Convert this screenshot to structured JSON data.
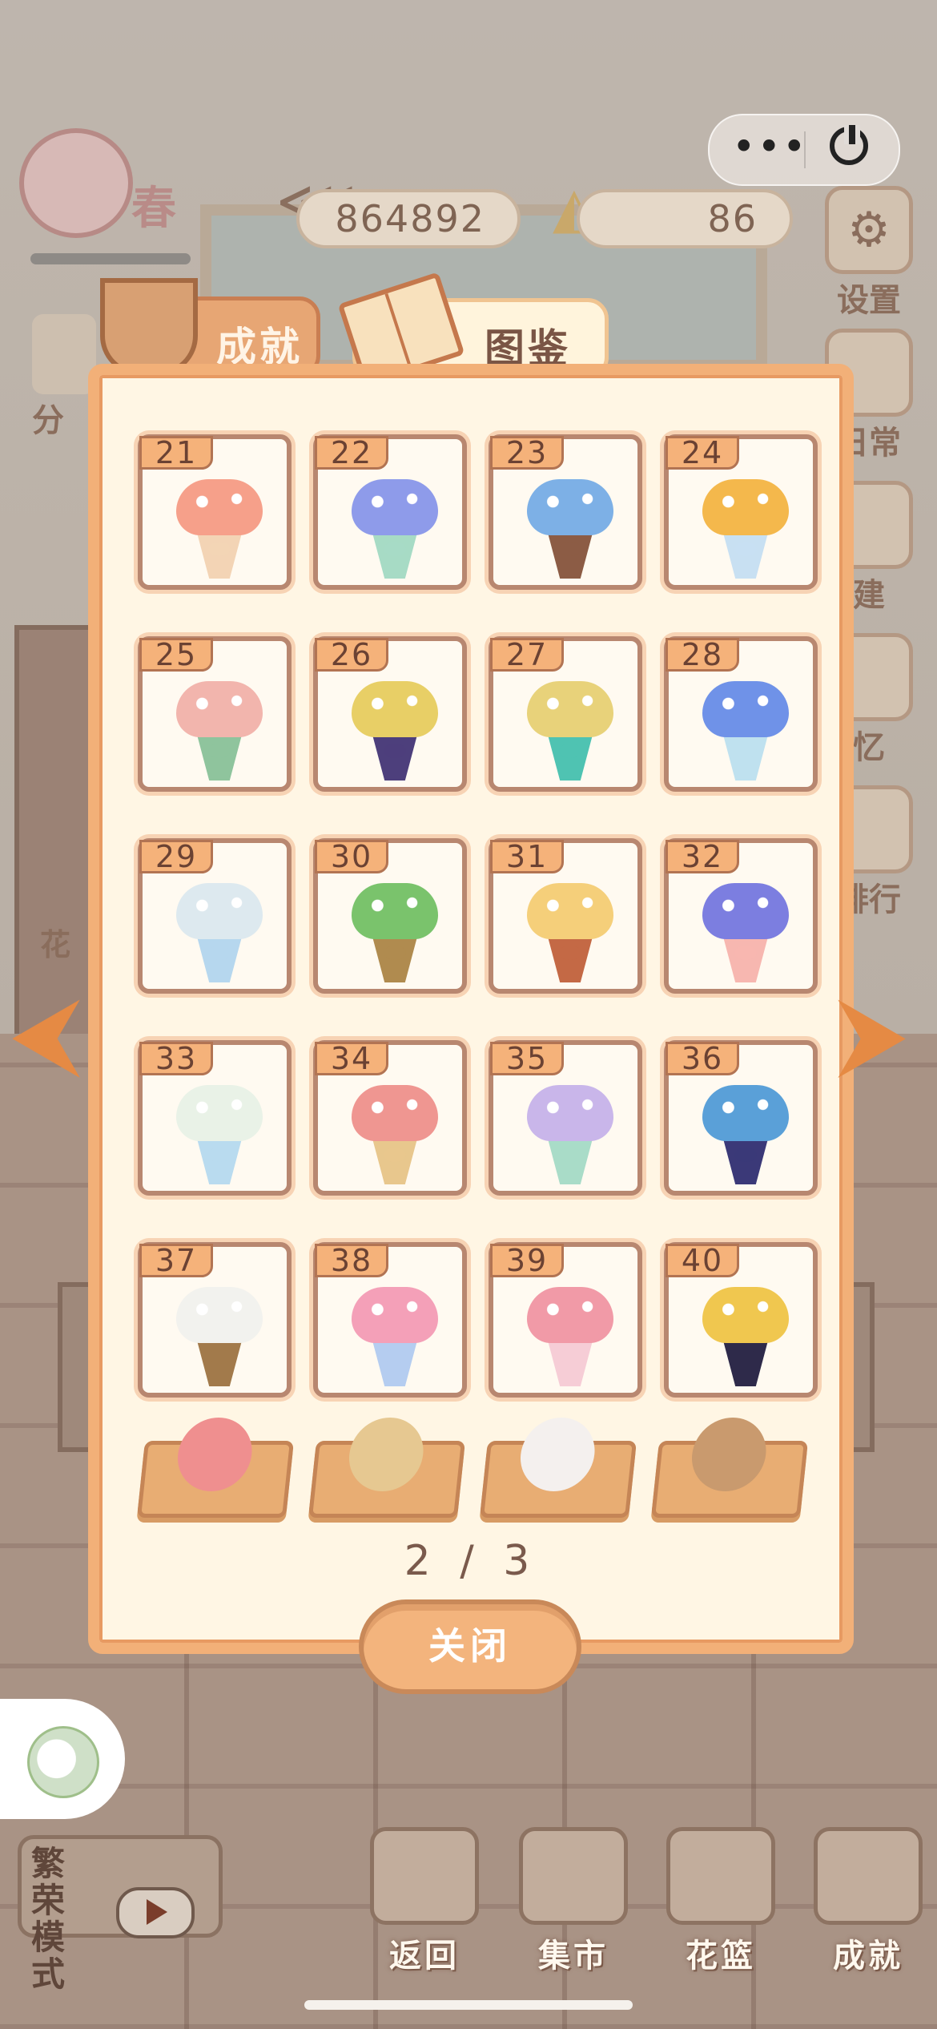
{
  "hud": {
    "season": "春",
    "fish_currency": "864892",
    "cheese_currency": "86",
    "settings_label": "设置"
  },
  "side_labels": {
    "left_top": "分",
    "right_1": "日常",
    "right_2": "建",
    "right_3": "忆",
    "right_4": "排行",
    "shelf_label": "花"
  },
  "tabs": {
    "achievements": "成就",
    "collection": "图鉴"
  },
  "collection": {
    "page": "2 / 3",
    "items": [
      {
        "num": "21",
        "color": "#f6a08a",
        "wrap": "#f3d4b5"
      },
      {
        "num": "22",
        "color": "#8e9bea",
        "wrap": "#a7dbc5"
      },
      {
        "num": "23",
        "color": "#7db0e6",
        "wrap": "#8c5c45"
      },
      {
        "num": "24",
        "color": "#f4b84c",
        "wrap": "#c8e0f2"
      },
      {
        "num": "25",
        "color": "#f2b5ad",
        "wrap": "#8fc49d"
      },
      {
        "num": "26",
        "color": "#e8cf66",
        "wrap": "#4d3f7c"
      },
      {
        "num": "27",
        "color": "#e8d27a",
        "wrap": "#4fc3b2"
      },
      {
        "num": "28",
        "color": "#6f92e8",
        "wrap": "#bfe1ef"
      },
      {
        "num": "29",
        "color": "#dde9ef",
        "wrap": "#b6d7ee"
      },
      {
        "num": "30",
        "color": "#7ac36c",
        "wrap": "#b08b4f"
      },
      {
        "num": "31",
        "color": "#f5cf7a",
        "wrap": "#c46945"
      },
      {
        "num": "32",
        "color": "#7c7ee0",
        "wrap": "#f7b7b0"
      },
      {
        "num": "33",
        "color": "#e9f2e7",
        "wrap": "#b9dbef"
      },
      {
        "num": "34",
        "color": "#ef9691",
        "wrap": "#e8c78d"
      },
      {
        "num": "35",
        "color": "#c9b6ea",
        "wrap": "#a9dcc8"
      },
      {
        "num": "36",
        "color": "#5aa0d8",
        "wrap": "#3b3978"
      },
      {
        "num": "37",
        "color": "#f2f2ee",
        "wrap": "#a27a4b"
      },
      {
        "num": "38",
        "color": "#f4a0b8",
        "wrap": "#b5cdf0"
      },
      {
        "num": "39",
        "color": "#f19aa7",
        "wrap": "#f6cdd6"
      },
      {
        "num": "40",
        "color": "#f0c74f",
        "wrap": "#2e2a4a"
      }
    ],
    "subtabs": [
      {
        "name": "flower-subtab",
        "color": "#ef8f8f"
      },
      {
        "name": "bouquet-subtab",
        "color": "#e6c891"
      },
      {
        "name": "cat-subtab",
        "color": "#f4f0ee"
      },
      {
        "name": "photo-subtab",
        "color": "#c99a6e"
      }
    ],
    "close_label": "关闭"
  },
  "bottom": {
    "mode_label": "繁荣模式",
    "nav": [
      "返回",
      "集市",
      "花篮",
      "成就"
    ]
  }
}
